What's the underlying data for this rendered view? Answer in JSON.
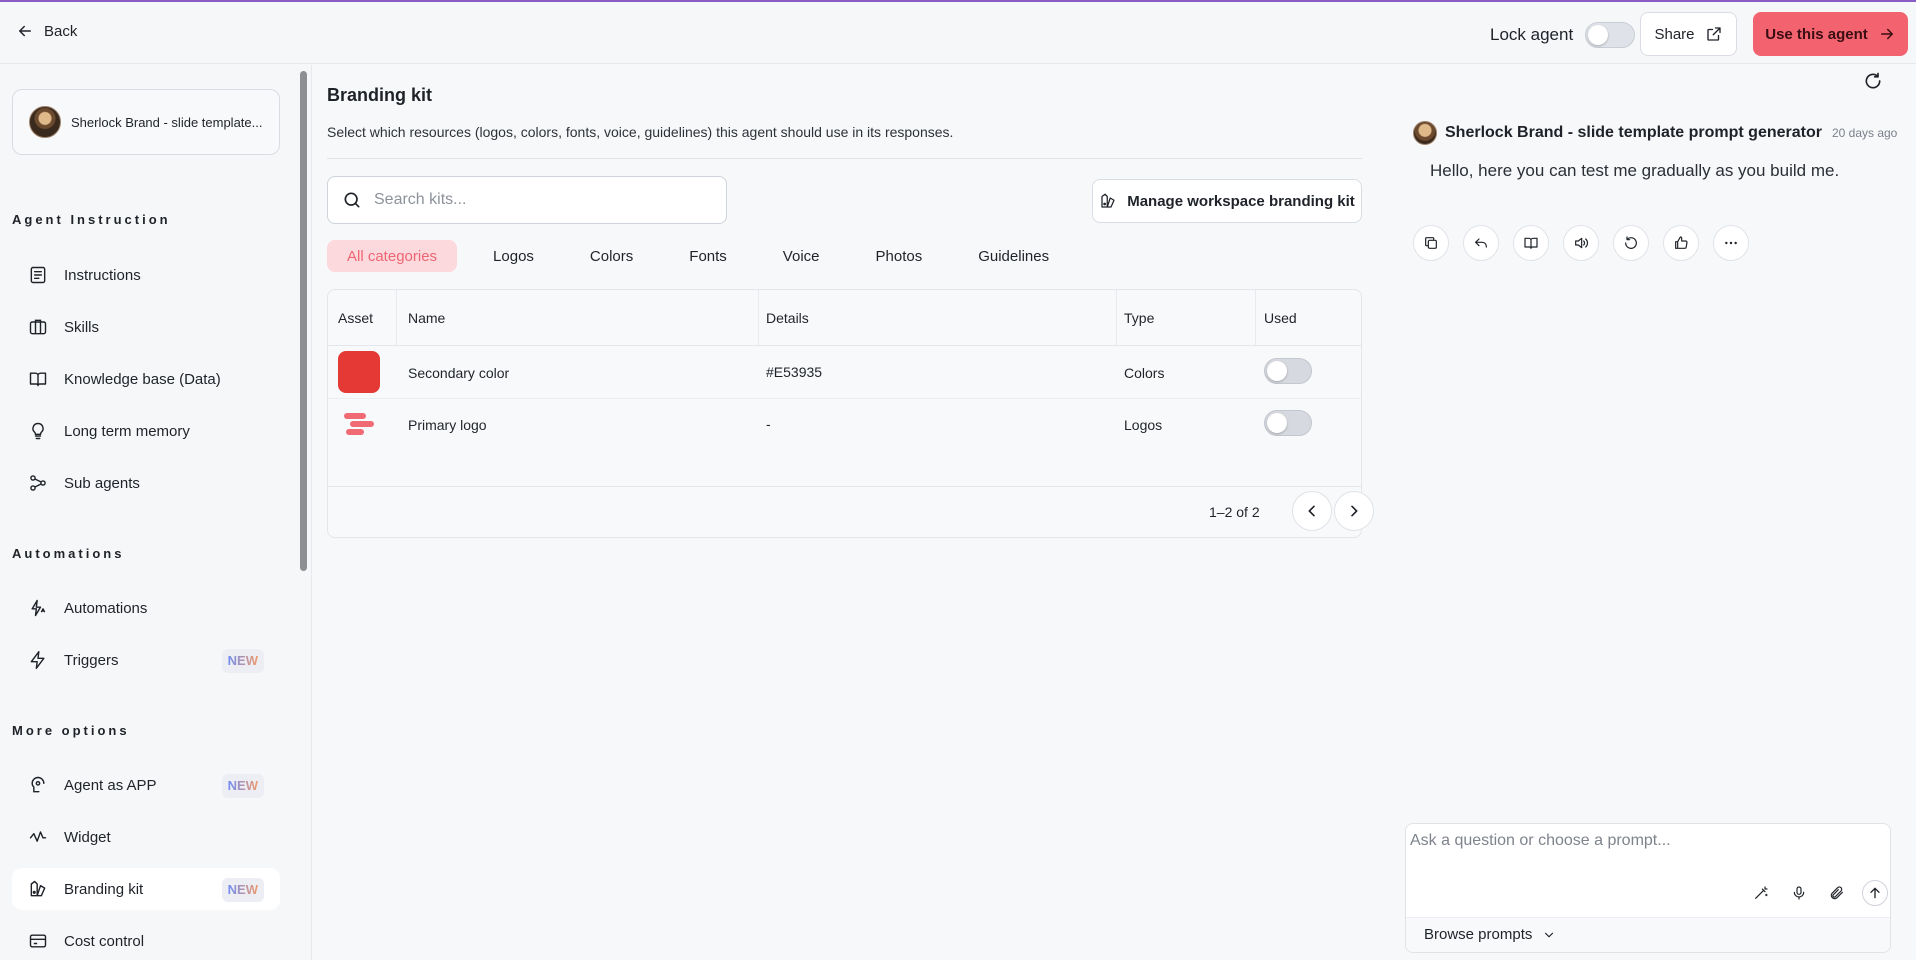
{
  "topbar": {
    "back_label": "Back",
    "lock_label": "Lock agent",
    "lock_enabled": false,
    "share_label": "Share",
    "use_label": "Use this agent"
  },
  "sidebar": {
    "agent_name": "Sherlock Brand - slide template...",
    "sections": [
      {
        "title": "Agent Instruction",
        "items": [
          {
            "label": "Instructions",
            "icon": "instructions-icon"
          },
          {
            "label": "Skills",
            "icon": "skills-icon"
          },
          {
            "label": "Knowledge base (Data)",
            "icon": "book-icon"
          },
          {
            "label": "Long term memory",
            "icon": "lightbulb-icon"
          },
          {
            "label": "Sub agents",
            "icon": "sub-agents-icon"
          }
        ]
      },
      {
        "title": "Automations",
        "items": [
          {
            "label": "Automations",
            "icon": "automation-icon"
          },
          {
            "label": "Triggers",
            "icon": "lightning-icon",
            "badge": "NEW"
          }
        ]
      },
      {
        "title": "More options",
        "items": [
          {
            "label": "Agent as APP",
            "icon": "app-icon",
            "badge": "NEW"
          },
          {
            "label": "Widget",
            "icon": "widget-icon"
          },
          {
            "label": "Branding kit",
            "icon": "branding-icon",
            "badge": "NEW",
            "active": true
          },
          {
            "label": "Cost control",
            "icon": "card-icon"
          }
        ]
      }
    ]
  },
  "main": {
    "title": "Branding kit",
    "subtitle": "Select which resources (logos, colors, fonts, voice, guidelines) this agent should use in its responses.",
    "search_placeholder": "Search kits...",
    "manage_label": "Manage workspace branding kit",
    "tabs": [
      {
        "label": "All categories",
        "active": true
      },
      {
        "label": "Logos"
      },
      {
        "label": "Colors"
      },
      {
        "label": "Fonts"
      },
      {
        "label": "Voice"
      },
      {
        "label": "Photos"
      },
      {
        "label": "Guidelines"
      }
    ],
    "table": {
      "headers": {
        "asset": "Asset",
        "name": "Name",
        "details": "Details",
        "type": "Type",
        "used": "Used"
      },
      "rows": [
        {
          "asset": "color-swatch",
          "swatch_color": "#E53935",
          "name": "Secondary color",
          "details": "#E53935",
          "type": "Colors",
          "used": false
        },
        {
          "asset": "logo-image",
          "name": "Primary logo",
          "details": "-",
          "type": "Logos",
          "used": false
        }
      ],
      "pager_text": "1–2 of 2"
    }
  },
  "chat": {
    "agent_name": "Sherlock Brand - slide template prompt generator",
    "time": "20 days ago",
    "message": "Hello, here you can test me gradually as you build me.",
    "actions": [
      "copy-icon",
      "reply-icon",
      "book-icon",
      "speaker-icon",
      "retry-icon",
      "thumbs-up-icon",
      "more-icon"
    ],
    "input_placeholder": "Ask a question or choose a prompt...",
    "browse_label": "Browse prompts"
  },
  "colors": {
    "accent": "#F2636F",
    "tab_active_bg": "#FBD9DD",
    "tab_active_text": "#EE6673",
    "swatch": "#E53935"
  }
}
